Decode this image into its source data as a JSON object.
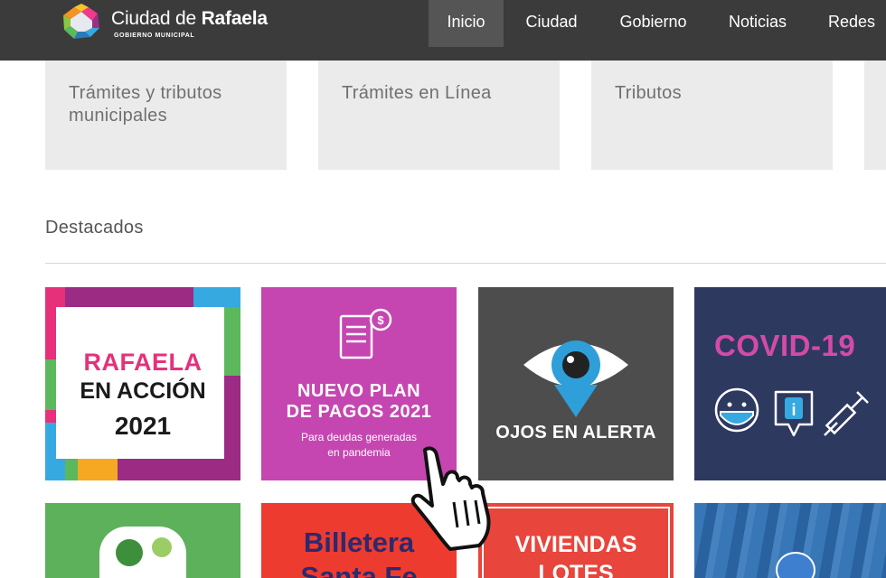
{
  "header": {
    "brand_light": "Ciudad de ",
    "brand_bold": "Rafaela",
    "brand_sub": "GOBIERNO MUNICIPAL",
    "nav": [
      "Inicio",
      "Ciudad",
      "Gobierno",
      "Noticias",
      "Redes"
    ]
  },
  "shortcuts": [
    "Trámites y tributos\nmunicipales",
    "Trámites en Línea",
    "Tributos"
  ],
  "featured": {
    "title": "Destacados",
    "tiles": [
      {
        "line1": "RAFAELA",
        "line2": "EN ACCIÓN",
        "line3": "2021"
      },
      {
        "line1": "NUEVO PLAN",
        "line2": "DE PAGOS 2021",
        "line3": "Para deudas generadas",
        "line4": "en pandemia"
      },
      {
        "line1": "OJOS EN ALERTA"
      },
      {
        "line1": "COVID-19"
      }
    ],
    "row2": [
      {
        "line1": ""
      },
      {
        "line1": "Billetera",
        "line2": "Santa Fe"
      },
      {
        "line1": "VIVIENDAS",
        "line2": "LOTES"
      },
      {
        "line1": ""
      }
    ]
  },
  "colors": {
    "navbar": "#3b3b3b",
    "shortcut_bg": "#ebebeb",
    "plan_bg": "#c546b0",
    "ojos_bg": "#4d4d4d",
    "covid_bg": "#2e3960",
    "green_bg": "#5db15a",
    "red_bg": "#ed3b2f"
  }
}
